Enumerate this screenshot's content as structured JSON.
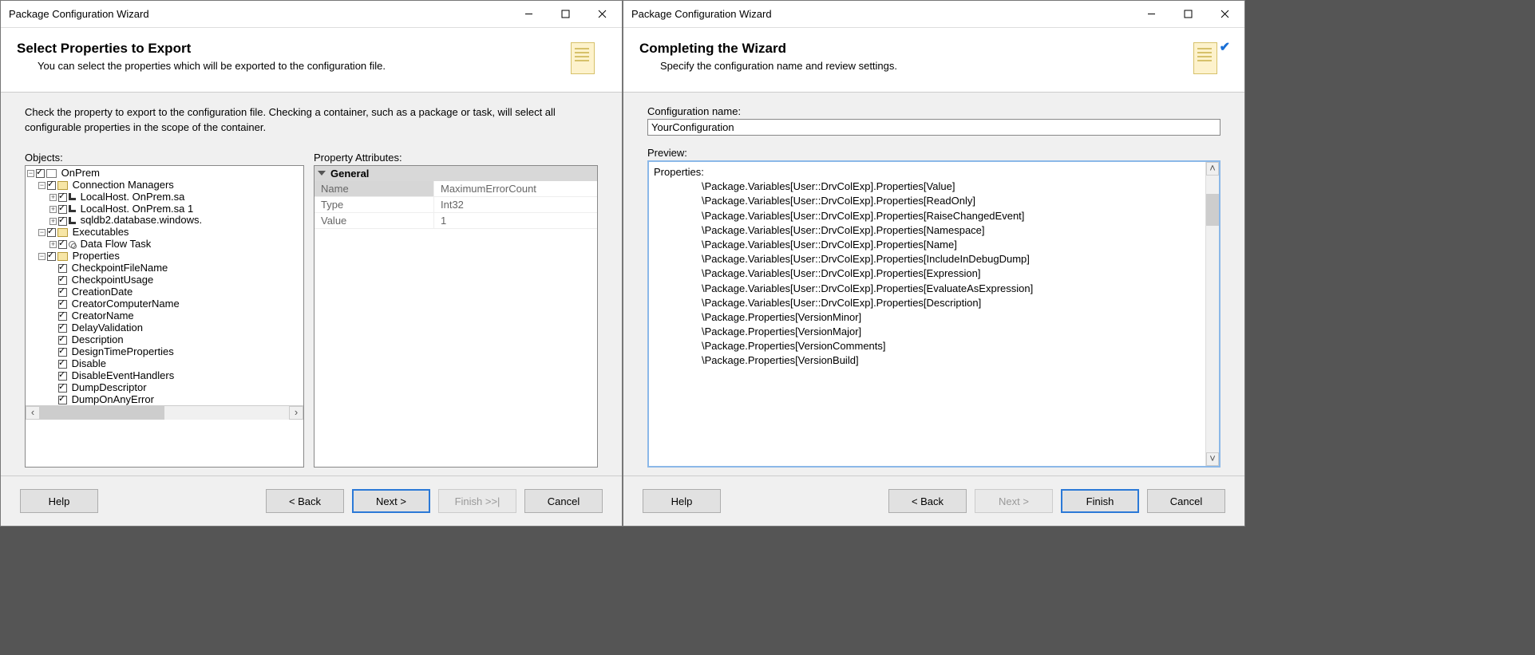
{
  "left": {
    "title": "Package Configuration Wizard",
    "heading": "Select Properties to Export",
    "subheading": "You can select the properties which will be exported to the configuration file.",
    "instruction": "Check the property to export to the configuration file. Checking a container, such as a package or task, will select all configurable properties in the scope of the container.",
    "objects_label": "Objects:",
    "attributes_label": "Property Attributes:",
    "pg_section": "General",
    "pg_rows": [
      {
        "name": "Name",
        "value": "MaximumErrorCount"
      },
      {
        "name": "Type",
        "value": "Int32"
      },
      {
        "name": "Value",
        "value": "1"
      }
    ],
    "tree": {
      "l0": "OnPrem",
      "l1a": "Connection Managers",
      "l2a": "LocalHost.             OnPrem.sa",
      "l2b": "LocalHost.             OnPrem.sa 1",
      "l2c": "             sqldb2.database.windows.",
      "l1b": "Executables",
      "l2d": "Data Flow Task",
      "l1c": "Properties",
      "props": [
        "CheckpointFileName",
        "CheckpointUsage",
        "CreationDate",
        "CreatorComputerName",
        "CreatorName",
        "DelayValidation",
        "Description",
        "DesignTimeProperties",
        "Disable",
        "DisableEventHandlers",
        "DumpDescriptor",
        "DumpOnAnyError"
      ]
    },
    "buttons": {
      "help": "Help",
      "back": "< Back",
      "next": "Next >",
      "finish": "Finish >>|",
      "cancel": "Cancel"
    }
  },
  "right": {
    "title": "Package Configuration Wizard",
    "heading": "Completing the Wizard",
    "subheading": "Specify the configuration name and review settings.",
    "name_label": "Configuration name:",
    "name_value": "YourConfiguration",
    "preview_label": "Preview:",
    "preview_header": "Properties:",
    "preview_lines": [
      "\\Package.Variables[User::DrvColExp].Properties[Value]",
      "\\Package.Variables[User::DrvColExp].Properties[ReadOnly]",
      "\\Package.Variables[User::DrvColExp].Properties[RaiseChangedEvent]",
      "\\Package.Variables[User::DrvColExp].Properties[Namespace]",
      "\\Package.Variables[User::DrvColExp].Properties[Name]",
      "\\Package.Variables[User::DrvColExp].Properties[IncludeInDebugDump]",
      "\\Package.Variables[User::DrvColExp].Properties[Expression]",
      "\\Package.Variables[User::DrvColExp].Properties[EvaluateAsExpression]",
      "\\Package.Variables[User::DrvColExp].Properties[Description]",
      "\\Package.Properties[VersionMinor]",
      "\\Package.Properties[VersionMajor]",
      "\\Package.Properties[VersionComments]",
      "\\Package.Properties[VersionBuild]"
    ],
    "buttons": {
      "help": "Help",
      "back": "< Back",
      "next": "Next >",
      "finish": "Finish",
      "cancel": "Cancel"
    }
  }
}
